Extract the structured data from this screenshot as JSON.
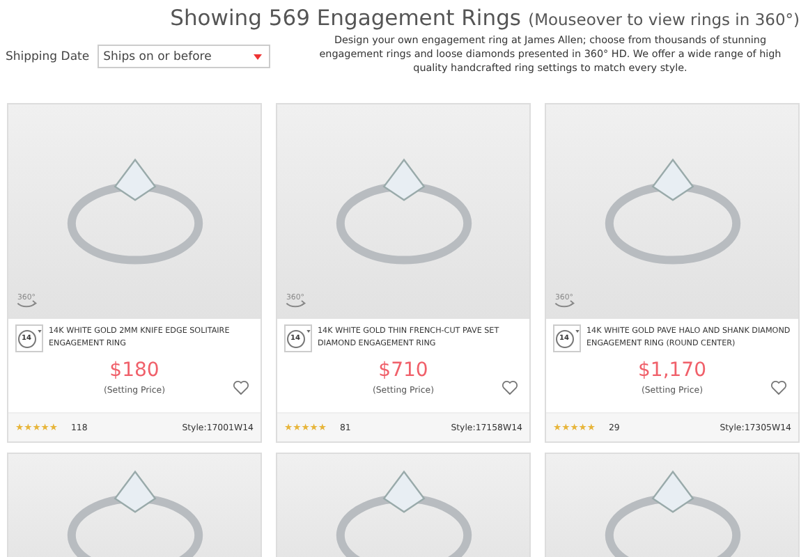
{
  "header": {
    "title": "Showing 569 Engagement Rings",
    "title_note": "(Mouseover to view rings in 360°)",
    "description": "Design your own engagement ring at James Allen; choose from thousands of stunning engagement rings and loose diamonds presented in 360° HD. We offer a wide range of high quality handcrafted ring settings to match every style."
  },
  "filter": {
    "label": "Shipping Date",
    "value": "Ships on or before"
  },
  "products": [
    {
      "kind": "full",
      "view_label": "360°",
      "metal": "14",
      "name": "14K WHITE GOLD 2MM KNIFE EDGE SOLITAIRE ENGAGEMENT RING",
      "price": "$180",
      "price_note": "(Setting Price)",
      "stars": 5,
      "reviews": "118",
      "style": "Style:17001W14"
    },
    {
      "kind": "full",
      "view_label": "360°",
      "metal": "14",
      "name": "14K WHITE GOLD THIN FRENCH-CUT PAVE SET DIAMOND ENGAGEMENT RING",
      "price": "$710",
      "price_note": "(Setting Price)",
      "stars": 5,
      "reviews": "81",
      "style": "Style:17158W14"
    },
    {
      "kind": "full",
      "view_label": "360°",
      "metal": "14",
      "name": "14K WHITE GOLD PAVE HALO AND SHANK DIAMOND ENGAGEMENT RING (ROUND CENTER)",
      "price": "$1,170",
      "price_note": "(Setting Price)",
      "stars": 5,
      "reviews": "29",
      "style": "Style:17305W14"
    },
    {
      "kind": "cut"
    },
    {
      "kind": "cut"
    },
    {
      "kind": "cut"
    }
  ]
}
